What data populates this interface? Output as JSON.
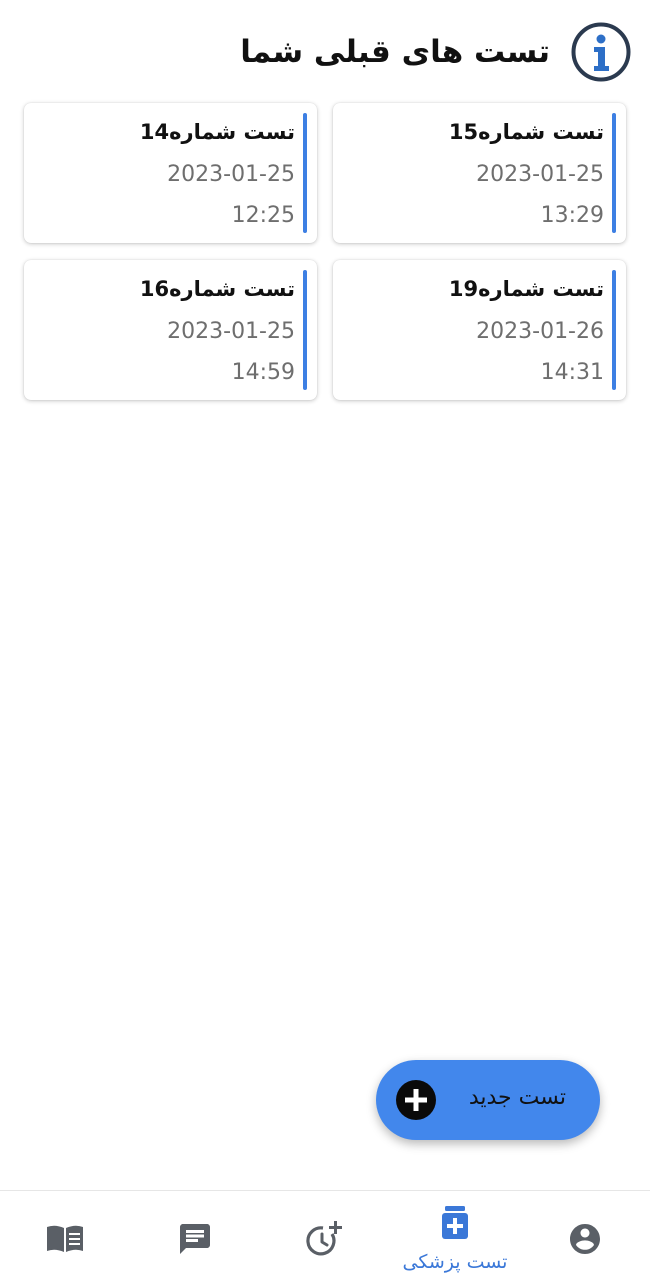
{
  "header": {
    "title": "تست های قبلی شما",
    "icon": "info-icon"
  },
  "cards": [
    {
      "title": "تست شماره15",
      "date": "2023-01-25",
      "time": "13:29"
    },
    {
      "title": "تست شماره14",
      "date": "2023-01-25",
      "time": "12:25"
    },
    {
      "title": "تست شماره19",
      "date": "2023-01-26",
      "time": "14:31"
    },
    {
      "title": "تست شماره16",
      "date": "2023-01-25",
      "time": "14:59"
    }
  ],
  "fab": {
    "label": "تست جدید",
    "icon": "plus-circle-icon"
  },
  "bottom_nav": {
    "items": [
      {
        "icon": "account-circle-icon"
      },
      {
        "icon": "medical-test-icon",
        "label": "تست پزشکی",
        "active": true
      },
      {
        "icon": "history-add-icon"
      },
      {
        "icon": "chat-message-icon"
      },
      {
        "icon": "book-icon"
      }
    ]
  },
  "colors": {
    "accent": "#3d7fe3",
    "fab": "#4287ec",
    "nav_active": "#3b78d8",
    "nav_inactive": "#5a5f66",
    "info_icon_ring": "#2b3a4f",
    "info_icon_glyph": "#2d6fc7"
  }
}
